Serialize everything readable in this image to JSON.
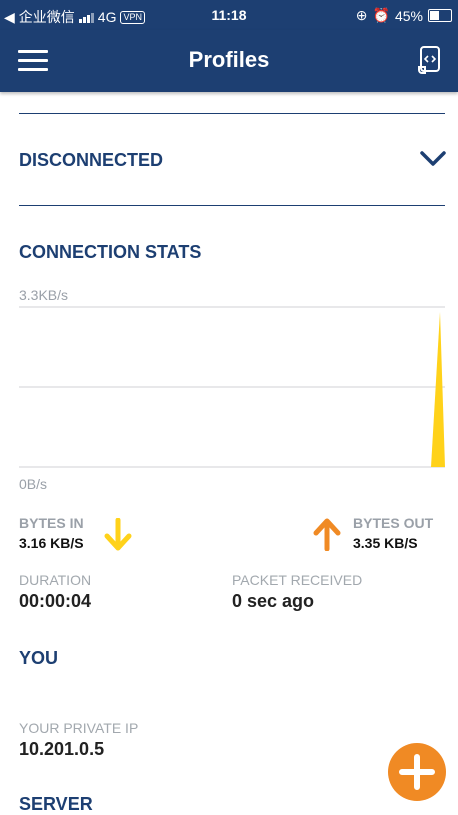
{
  "status_bar": {
    "carrier": "企业微信",
    "network": "4G",
    "vpn": "VPN",
    "time": "11:18",
    "battery": "45%"
  },
  "header": {
    "title": "Profiles"
  },
  "connection": {
    "status": "DISCONNECTED"
  },
  "stats": {
    "title": "CONNECTION STATS",
    "chart_max_label": "3.3KB/s",
    "chart_min_label": "0B/s",
    "bytes_in_label": "BYTES IN",
    "bytes_in_value": "3.16 KB/S",
    "bytes_out_label": "BYTES OUT",
    "bytes_out_value": "3.35 KB/S",
    "duration_label": "DURATION",
    "duration_value": "00:00:04",
    "packet_label": "PACKET RECEIVED",
    "packet_value": "0 sec ago"
  },
  "you": {
    "title": "YOU",
    "private_ip_label": "YOUR PRIVATE IP",
    "private_ip_value": "10.201.0.5"
  },
  "server": {
    "title": "SERVER"
  },
  "colors": {
    "header_bg": "#1d3f72",
    "accent_yellow": "#ffd21a",
    "accent_orange": "#f08a24"
  }
}
